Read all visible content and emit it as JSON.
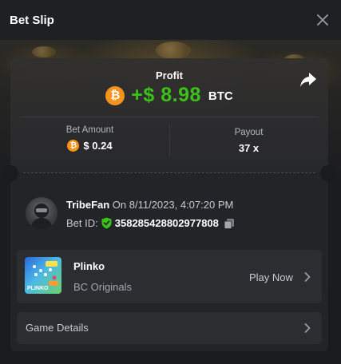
{
  "header": {
    "title": "Bet Slip"
  },
  "profit": {
    "label": "Profit",
    "amount": "+$ 8.98",
    "currency": "BTC",
    "coin_glyph": "₿"
  },
  "stats": {
    "bet_amount_label": "Bet Amount",
    "bet_amount_value": "$ 0.24",
    "payout_label": "Payout",
    "payout_value": "37 x"
  },
  "user": {
    "name": "TribeFan",
    "date_text": " On 8/11/2023, 4:07:20 PM",
    "bet_id_label": "Bet ID:",
    "bet_id": "358285428802977808"
  },
  "game": {
    "name": "Plinko",
    "provider": "BC Originals",
    "thumb_text": "PLINKO",
    "play_label": "Play Now"
  },
  "details": {
    "label": "Game Details"
  },
  "colors": {
    "profit_green": "#3bc117",
    "btc_orange": "#f7931a",
    "verified_green": "#3bc117",
    "background": "#1a1b1e"
  },
  "icons": {
    "close": "close-icon",
    "share": "share-icon",
    "coin": "bitcoin-icon",
    "verified": "shield-check-icon",
    "copy": "copy-icon",
    "chevron": "chevron-right-icon"
  }
}
